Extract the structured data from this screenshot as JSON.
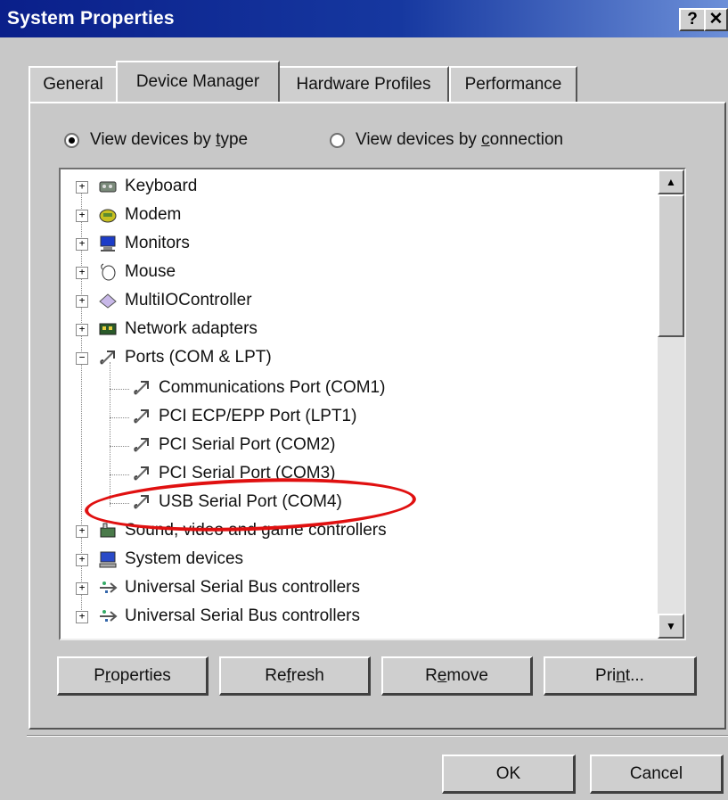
{
  "window": {
    "title": "System Properties",
    "help_label": "?",
    "close_label": "✕"
  },
  "tabs": [
    {
      "label": "General",
      "active": false
    },
    {
      "label": "Device Manager",
      "active": true
    },
    {
      "label": "Hardware Profiles",
      "active": false
    },
    {
      "label": "Performance",
      "active": false
    }
  ],
  "view": {
    "by_type_pre": "View devices by ",
    "by_type_u": "t",
    "by_type_post": "ype",
    "by_connection_pre": "View devices by ",
    "by_connection_u": "c",
    "by_connection_post": "onnection",
    "selected": "by_type"
  },
  "tree": {
    "items": [
      {
        "label": "Keyboard",
        "icon": "keyboard-icon",
        "expander": "+"
      },
      {
        "label": "Modem",
        "icon": "modem-icon",
        "expander": "+"
      },
      {
        "label": "Monitors",
        "icon": "monitor-icon",
        "expander": "+"
      },
      {
        "label": "Mouse",
        "icon": "mouse-icon",
        "expander": "+"
      },
      {
        "label": "MultiIOController",
        "icon": "controller-icon",
        "expander": "+"
      },
      {
        "label": "Network adapters",
        "icon": "network-adapter-icon",
        "expander": "+"
      },
      {
        "label": "Ports (COM & LPT)",
        "icon": "port-icon",
        "expander": "−"
      },
      {
        "label": "Communications Port (COM1)",
        "icon": "port-icon"
      },
      {
        "label": "PCI ECP/EPP  Port (LPT1)",
        "icon": "port-icon"
      },
      {
        "label": "PCI Serial Port (COM2)",
        "icon": "port-icon"
      },
      {
        "label": "PCI Serial Port (COM3)",
        "icon": "port-icon"
      },
      {
        "label": "USB Serial Port (COM4)",
        "icon": "port-icon",
        "highlighted": true
      },
      {
        "label": "Sound, video and game controllers",
        "icon": "sound-icon",
        "expander": "+"
      },
      {
        "label": "System devices",
        "icon": "system-devices-icon",
        "expander": "+"
      },
      {
        "label": "Universal Serial Bus controllers",
        "icon": "usb-icon",
        "expander": "+"
      },
      {
        "label": "Universal Serial Bus controllers",
        "icon": "usb-icon",
        "expander": "+"
      }
    ]
  },
  "buttons": {
    "properties_pre": "P",
    "properties_u": "r",
    "properties_post": "operties",
    "refresh_pre": "Re",
    "refresh_u": "f",
    "refresh_post": "resh",
    "remove_pre": "R",
    "remove_u": "e",
    "remove_post": "move",
    "print_pre": "Pri",
    "print_u": "n",
    "print_post": "t...",
    "ok": "OK",
    "cancel": "Cancel"
  },
  "colors": {
    "title_bar": "#0a1f8a",
    "highlight_ellipse": "#e01010"
  }
}
